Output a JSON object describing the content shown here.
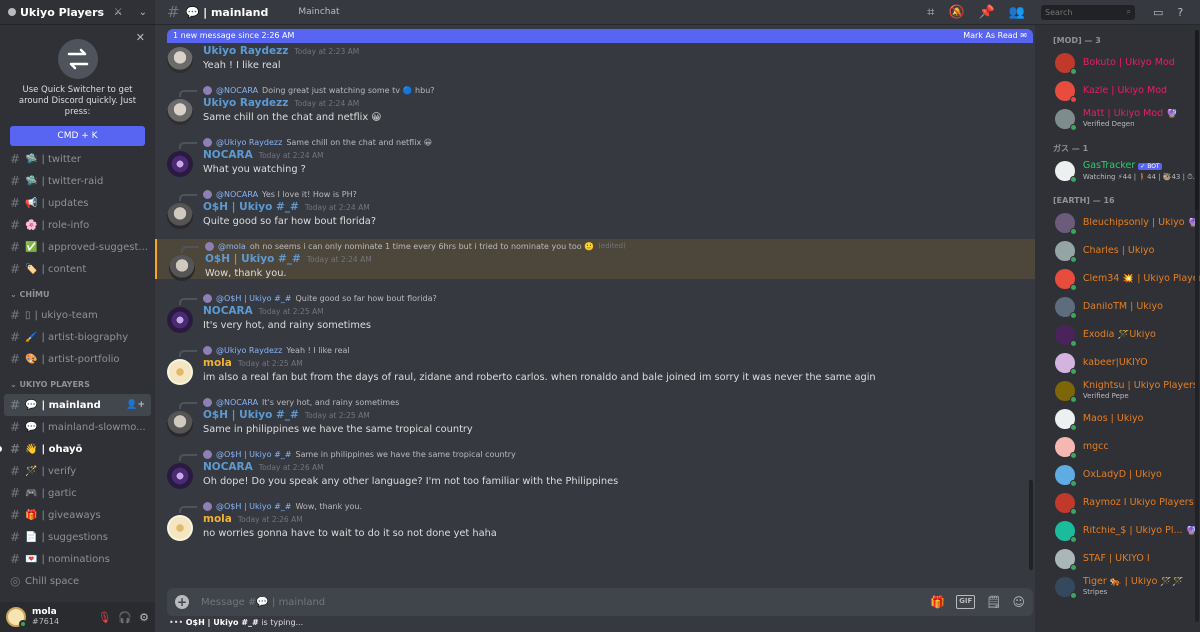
{
  "server": {
    "name": "Ukiyo Players"
  },
  "quick_switcher": {
    "text": "Use Quick Switcher to get around Discord quickly. Just press:",
    "shortcut": "CMD + K",
    "close": "✕"
  },
  "channels_top": [
    {
      "icon": "🛸",
      "name": "| twitter"
    },
    {
      "icon": "🛸",
      "name": "| twitter-raid"
    },
    {
      "icon": "📢",
      "name": "| updates"
    },
    {
      "icon": "🌸",
      "name": "| role-info"
    },
    {
      "icon": "✅",
      "name": "| approved-suggest..."
    },
    {
      "icon": "🏷️",
      "name": "| content"
    }
  ],
  "category_chimu": "CHĪMU",
  "channels_chimu": [
    {
      "icon": "▯",
      "name": "| ukiyo-team"
    },
    {
      "icon": "🖌️",
      "name": "| artist-biography"
    },
    {
      "icon": "🎨",
      "name": "| artist-portfolio"
    }
  ],
  "category_ukiyo": "UKIYO PLAYERS",
  "channels_ukiyo": [
    {
      "icon": "💬",
      "name": "| mainland",
      "state": "active"
    },
    {
      "icon": "💬",
      "name": "| mainland-slowmo...",
      "state": ""
    },
    {
      "icon": "👋",
      "name": "| ohayō",
      "state": "unread"
    },
    {
      "icon": "🪄",
      "name": "| verify",
      "state": ""
    },
    {
      "icon": "🎮",
      "name": "| gartic",
      "state": ""
    },
    {
      "icon": "🎁",
      "name": "| giveaways",
      "state": ""
    },
    {
      "icon": "📄",
      "name": "| suggestions",
      "state": ""
    },
    {
      "icon": "💌",
      "name": "| nominations",
      "state": ""
    }
  ],
  "voice_channel": "Chill space",
  "user_panel": {
    "name": "mola",
    "tag": "#7614"
  },
  "topbar": {
    "channel": "💬 | mainland",
    "topic": "Mainchat"
  },
  "banner": {
    "left": "1 new message since 2:26 AM",
    "right": "Mark As Read"
  },
  "messages": [
    {
      "reply": null,
      "author": "Ukiyo Raydezz",
      "author_color": "#5b9bd5",
      "avatar": "ray",
      "time": "Today at 2:23 AM",
      "text": "Yeah ! I like real",
      "highlight": false
    },
    {
      "reply": {
        "name": "@NOCARA",
        "text": "Doing great just watching some tv 🔵 hbu?"
      },
      "author": "Ukiyo Raydezz",
      "author_color": "#5b9bd5",
      "avatar": "ray",
      "time": "Today at 2:24 AM",
      "text": "Same chill on the chat and netflix 😀",
      "highlight": false
    },
    {
      "reply": {
        "name": "@Ukiyo Raydezz",
        "text": "Same chill on the chat and netflix 😀"
      },
      "author": "NOCARA",
      "author_color": "#5b9bd5",
      "avatar": "noc",
      "time": "Today at 2:24 AM",
      "text": "What you watching ?",
      "highlight": false
    },
    {
      "reply": {
        "name": "@NOCARA",
        "text": "Yes I love it! How is PH?"
      },
      "author": "O$H | Ukiyo #_#",
      "author_color": "#5b9bd5",
      "avatar": "osh",
      "time": "Today at 2:24 AM",
      "text": "Quite good so far how bout florida?",
      "highlight": false
    },
    {
      "reply": {
        "name": "@mola",
        "text": "oh no seems i can only nominate 1 time every 6hrs but i tried to nominate you too 🙂",
        "edited": "(edited)"
      },
      "author": "O$H | Ukiyo #_#",
      "author_color": "#5b9bd5",
      "avatar": "osh",
      "time": "Today at 2:24 AM",
      "text": "Wow, thank you.",
      "highlight": true
    },
    {
      "reply": {
        "name": "@O$H | Ukiyo #_#",
        "text": "Quite good so far how bout florida?"
      },
      "author": "NOCARA",
      "author_color": "#5b9bd5",
      "avatar": "noc",
      "time": "Today at 2:25 AM",
      "text": "It's very hot, and rainy sometimes",
      "highlight": false
    },
    {
      "reply": {
        "name": "@Ukiyo Raydezz",
        "text": "Yeah ! I like real"
      },
      "author": "mola",
      "author_color": "#f0b232",
      "avatar": "mola",
      "time": "Today at 2:25 AM",
      "text": "im also a real fan but from the days of raul, zidane and roberto carlos. when ronaldo and bale joined im sorry it was never the same agin",
      "highlight": false
    },
    {
      "reply": {
        "name": "@NOCARA",
        "text": "It's very hot, and rainy sometimes"
      },
      "author": "O$H | Ukiyo #_#",
      "author_color": "#5b9bd5",
      "avatar": "osh",
      "time": "Today at 2:25 AM",
      "text": "Same in philippines we have the same tropical country",
      "highlight": false
    },
    {
      "reply": {
        "name": "@O$H | Ukiyo #_#",
        "text": "Same in philippines we have the same tropical country"
      },
      "author": "NOCARA",
      "author_color": "#5b9bd5",
      "avatar": "noc",
      "time": "Today at 2:26 AM",
      "text": "Oh dope! Do you speak any other language? I'm not too familiar with the Philippines",
      "highlight": false
    },
    {
      "reply": {
        "name": "@O$H | Ukiyo #_#",
        "text": "Wow, thank you."
      },
      "author": "mola",
      "author_color": "#f0b232",
      "avatar": "mola",
      "time": "Today at 2:26 AM",
      "text": "no worries gonna have to wait to do it so not done yet haha",
      "highlight": false
    }
  ],
  "composer": {
    "placeholder": "Message #💬 | mainland"
  },
  "typing": {
    "who": "O$H | Ukiyo #_#",
    "rest": " is typing..."
  },
  "search": {
    "placeholder": "Search"
  },
  "member_groups": [
    {
      "label": "[MOD] — 3",
      "members": [
        {
          "name": "Bokuto | Ukiyo Mod",
          "color": "#e91e63",
          "sub": "",
          "status": "#3ba55d",
          "av": "#c0392b"
        },
        {
          "name": "Kazle | Ukiyo Mod",
          "color": "#e91e63",
          "sub": "",
          "status": "#ed4245",
          "av": "#e74c3c"
        },
        {
          "name": "Matt | Ukiyo Mod 🔮",
          "color": "#e91e63",
          "sub": "Verified Degen",
          "status": "#3ba55d",
          "av": "#7f8c8d"
        }
      ]
    },
    {
      "label": "ガス — 1",
      "members": [
        {
          "name": "GasTracker",
          "color": "#2ecc71",
          "bot": "✓ BOT",
          "sub": "Watching ⚡44 | 🚶44 | 🦥43 | ⏱...",
          "status": "#3ba55d",
          "av": "#ecf0f1"
        }
      ]
    },
    {
      "label": "[EARTH] — 16",
      "members": [
        {
          "name": "Bleuchipsonly | Ukiyo 🔮",
          "color": "#e67e22",
          "sub": "",
          "status": "#3ba55d",
          "av": "#6c5b7b"
        },
        {
          "name": "Charles | Ukiyo",
          "color": "#e67e22",
          "sub": "",
          "status": "#3ba55d",
          "av": "#95a5a6"
        },
        {
          "name": "Clem34 💥 | Ukiyo Players",
          "color": "#e67e22",
          "sub": "",
          "status": "#3ba55d",
          "av": "#e74c3c"
        },
        {
          "name": "DaniloTM | Ukiyo",
          "color": "#e67e22",
          "sub": "",
          "status": "#3ba55d",
          "av": "#5d6d7e"
        },
        {
          "name": "Exodia 🪄Ukiyo",
          "color": "#e67e22",
          "sub": "",
          "status": "#3ba55d",
          "av": "#4a235a"
        },
        {
          "name": "kabeer|UKIYO",
          "color": "#e67e22",
          "sub": "",
          "status": "#3ba55d",
          "av": "#d2b4de"
        },
        {
          "name": "Knightsu | Ukiyo Players",
          "color": "#e67e22",
          "sub": "Verified Pepe",
          "status": "#3ba55d",
          "av": "#7d6608"
        },
        {
          "name": "Maos | Ukiyo",
          "color": "#e67e22",
          "sub": "",
          "status": "#3ba55d",
          "av": "#ecf0f1"
        },
        {
          "name": "mgcc",
          "color": "#e67e22",
          "sub": "",
          "status": "#3ba55d",
          "av": "#f5b7b1"
        },
        {
          "name": "OxLadyD | Ukiyo",
          "color": "#e67e22",
          "sub": "",
          "status": "#3ba55d",
          "av": "#5dade2"
        },
        {
          "name": "Raymoz I Ukiyo Players",
          "color": "#e67e22",
          "sub": "",
          "status": "#3ba55d",
          "av": "#c0392b"
        },
        {
          "name": "Ritchie_$ | Ukiyo Pl... 🔮",
          "color": "#e67e22",
          "sub": "",
          "status": "#3ba55d",
          "av": "#1abc9c"
        },
        {
          "name": "STAF | UKIYO I",
          "color": "#e67e22",
          "sub": "",
          "status": "#3ba55d",
          "av": "#aab7b8"
        },
        {
          "name": "Tiger 🐅 | Ukiyo 🪄🪄",
          "color": "#e67e22",
          "sub": "Stripes",
          "status": "#3ba55d",
          "av": "#34495e"
        }
      ]
    }
  ]
}
